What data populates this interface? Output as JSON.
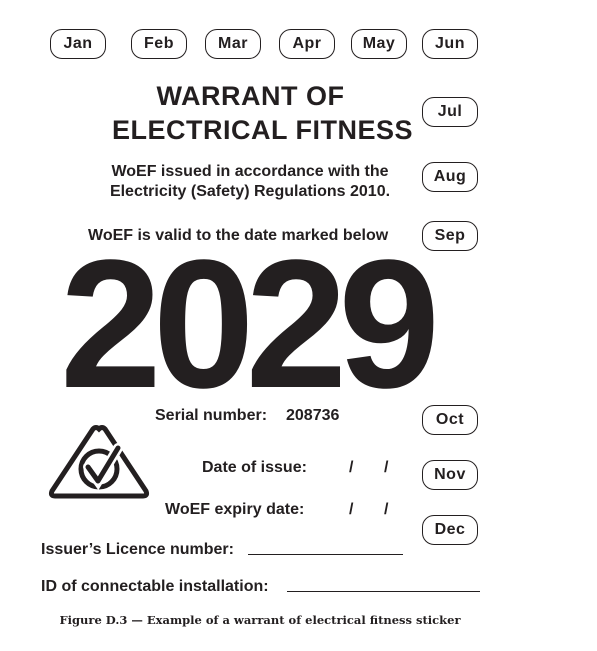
{
  "months": [
    "Jan",
    "Feb",
    "Mar",
    "Apr",
    "May",
    "Jun",
    "Jul",
    "Aug",
    "Sep",
    "Oct",
    "Nov",
    "Dec"
  ],
  "title": {
    "line1": "WARRANT OF",
    "line2": "ELECTRICAL FITNESS"
  },
  "regulation": {
    "line1": "WoEF issued in accordance with the",
    "line2": "Electricity (Safety) Regulations 2010."
  },
  "validity_text": "WoEF is valid to the date marked below",
  "year": "2029",
  "serial": {
    "label": "Serial number:",
    "value": "208736"
  },
  "date_of_issue": {
    "label": "Date of issue:",
    "slash1": "/",
    "slash2": "/"
  },
  "expiry_date": {
    "label": "WoEF expiry date:",
    "slash1": "/",
    "slash2": "/"
  },
  "licence_label": "Issuer’s Licence number:",
  "installation_label": "ID of connectable installation:",
  "caption": "Figure D.3 — Example of a warrant of electrical fitness sticker",
  "logo_icon": "rcm-compliance-mark-icon"
}
